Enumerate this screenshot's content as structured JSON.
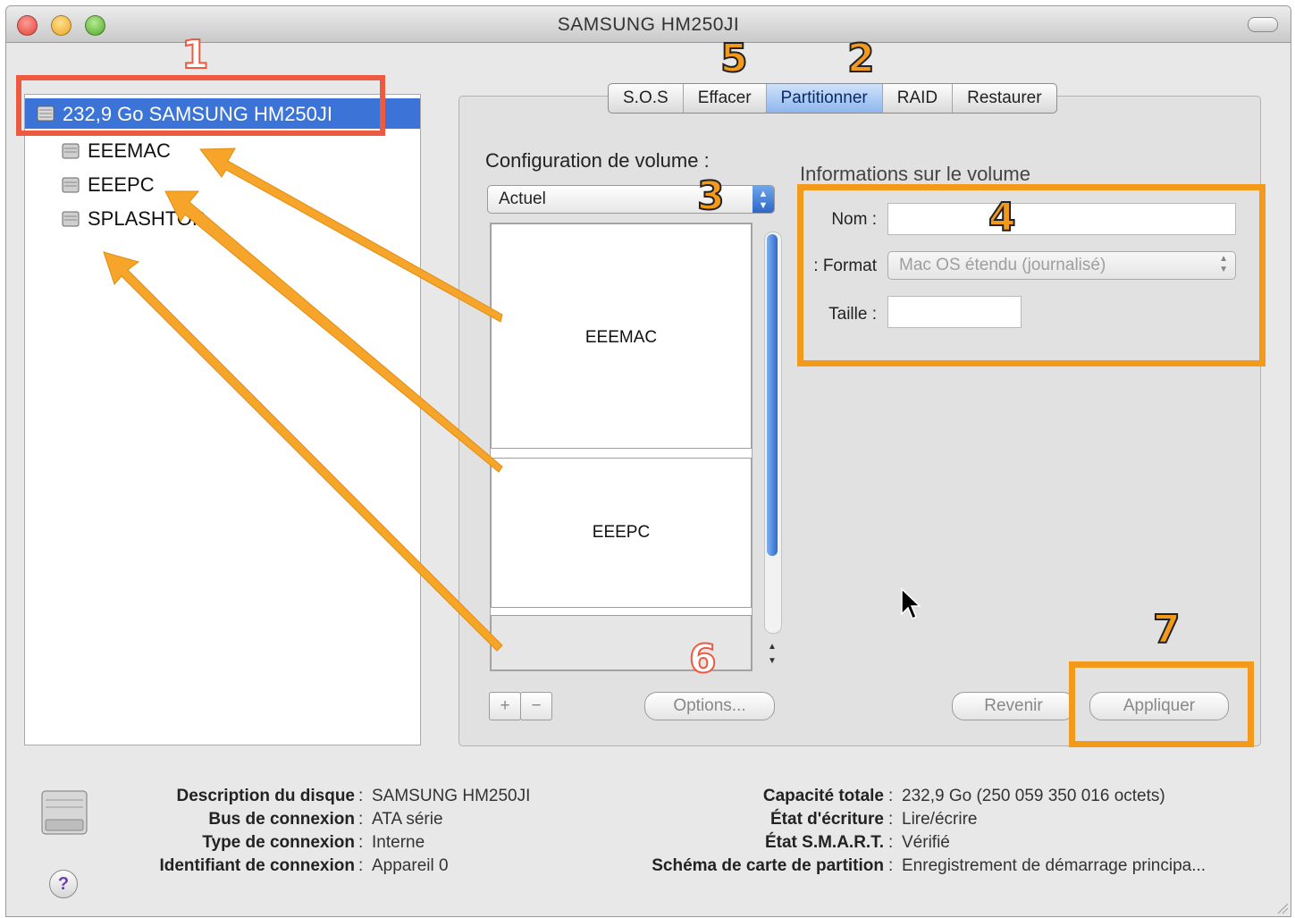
{
  "window": {
    "title": "SAMSUNG HM250JI"
  },
  "colors": {
    "close": "#ec5f57",
    "minimize": "#f4bf4f",
    "zoom": "#6fc34a",
    "selection": "#3b74d6",
    "annotation_orange": "#f39a1a",
    "annotation_red": "#ee5a3f"
  },
  "sidebar": {
    "drive": {
      "label": "232,9 Go SAMSUNG HM250JI",
      "icon": "hard-disk-icon"
    },
    "volumes": [
      {
        "label": "EEEMAC",
        "icon": "volume-icon"
      },
      {
        "label": "EEEPC",
        "icon": "volume-icon"
      },
      {
        "label": "SPLASHTOP",
        "icon": "volume-icon"
      }
    ]
  },
  "tabs": [
    {
      "label": "S.O.S",
      "active": false
    },
    {
      "label": "Effacer",
      "active": false
    },
    {
      "label": "Partitionner",
      "active": true
    },
    {
      "label": "RAID",
      "active": false
    },
    {
      "label": "Restaurer",
      "active": false
    }
  ],
  "partition": {
    "config_heading": "Configuration de volume :",
    "scheme_select": "Actuel",
    "segments": [
      "EEEMAC",
      "EEEPC",
      ""
    ],
    "add_label": "+",
    "remove_label": "−",
    "options_label": "Options..."
  },
  "volume_info": {
    "heading": "Informations sur le volume",
    "name_label": "Nom :",
    "name_value": "",
    "format_label": "Format :",
    "format_value": "Mac OS étendu (journalisé)",
    "size_label": "Taille :",
    "size_value": ""
  },
  "actions": {
    "revert_label": "Revenir",
    "apply_label": "Appliquer"
  },
  "disk_info": {
    "left": [
      {
        "key": "Description du disque",
        "value": "SAMSUNG HM250JI"
      },
      {
        "key": "Bus de connexion",
        "value": "ATA série"
      },
      {
        "key": "Type de connexion",
        "value": "Interne"
      },
      {
        "key": "Identifiant de connexion",
        "value": "Appareil 0"
      }
    ],
    "right": [
      {
        "key": "Capacité totale",
        "value": "232,9 Go (250 059 350 016 octets)"
      },
      {
        "key": "État d'écriture",
        "value": "Lire/écrire"
      },
      {
        "key": "État S.M.A.R.T.",
        "value": "Vérifié"
      },
      {
        "key": "Schéma de carte de partition",
        "value": "Enregistrement de démarrage principa..."
      }
    ],
    "separator": ":",
    "help_label": "?"
  },
  "annotations": [
    "1",
    "2",
    "3",
    "4",
    "5",
    "6",
    "7"
  ]
}
